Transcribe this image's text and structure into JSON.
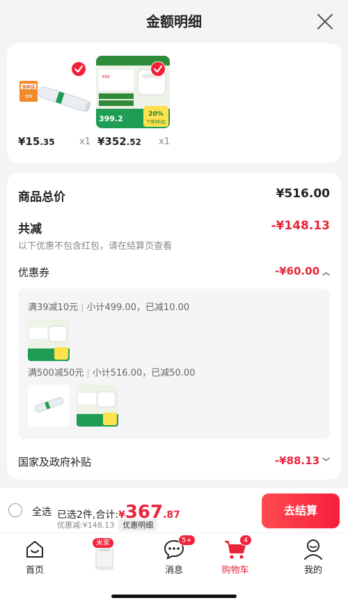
{
  "sheet": {
    "title": "金额明细"
  },
  "items": [
    {
      "price_int": "¥15",
      "price_dec": ".35",
      "qty": "x1",
      "checked": true
    },
    {
      "price_int": "¥352",
      "price_dec": ".52",
      "qty": "x1",
      "checked": true
    }
  ],
  "product_image_text": {
    "wrap": {
      "brand": "保鲜袋",
      "tag": "直降"
    },
    "cooker": {
      "price": "399.2",
      "promo_pct": "20%",
      "promo_text": "下单8折起",
      "old_price": "499"
    }
  },
  "summary": {
    "total_label": "商品总价",
    "total_value": "¥516.00",
    "reduce_label": "共减",
    "reduce_value": "-¥148.13",
    "reduce_note": "以下优惠不包含红包，请在结算页查看",
    "coupon_label": "优惠券",
    "coupon_value": "-¥60.00",
    "coupon_rules": [
      {
        "rule": "满39减10元",
        "detail": "小计499.00，已减10.00"
      },
      {
        "rule": "满500减50元",
        "detail": "小计516.00，已减50.00"
      }
    ],
    "subsidy_label": "国家及政府补贴",
    "subsidy_value": "-¥88.13"
  },
  "bottom_bar": {
    "select_all": "全选",
    "selected_text": "已选2件,合计:",
    "total_currency": "¥",
    "total_int": "367",
    "total_dec": ".87",
    "discount_text": "优惠减:¥148.13",
    "detail_button": "优惠明细",
    "checkout_button": "去结算"
  },
  "tabbar": {
    "tabs": [
      {
        "label": "首页",
        "icon": "home-icon"
      },
      {
        "label": "",
        "icon": "robot-vacuum-product",
        "badge": "米家"
      },
      {
        "label": "消息",
        "icon": "message-icon",
        "badge": "5+"
      },
      {
        "label": "购物车",
        "icon": "cart-icon",
        "badge": "4",
        "active": true
      },
      {
        "label": "我的",
        "icon": "profile-icon"
      }
    ]
  },
  "colors": {
    "accent": "#e8243a",
    "checkout_gradient_start": "#ff4a50",
    "checkout_gradient_end": "#f5203c",
    "sheet_bg": "#f4f4f4"
  }
}
